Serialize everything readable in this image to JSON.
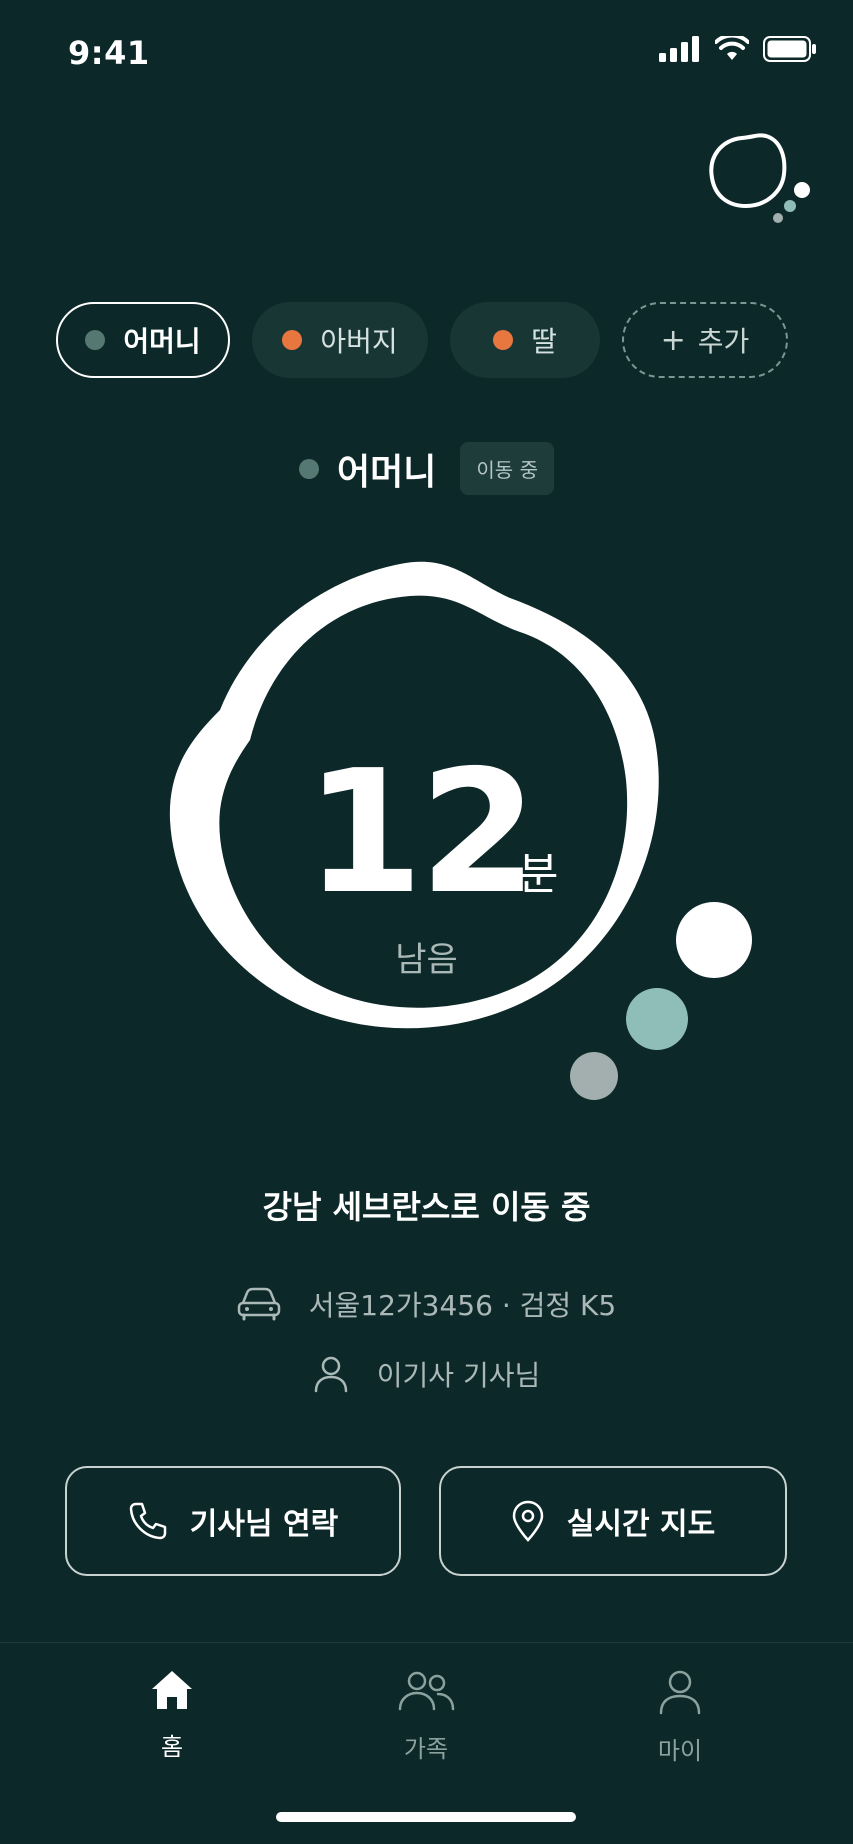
{
  "status_bar": {
    "time": "9:41"
  },
  "chips": [
    {
      "label": "어머니",
      "dot_color": "#557873",
      "active": true
    },
    {
      "label": "아버지",
      "dot_color": "#e8773f",
      "active": false
    },
    {
      "label": "딸",
      "dot_color": "#e8773f",
      "active": false
    }
  ],
  "add_chip": {
    "plus": "+",
    "label": "추가"
  },
  "selected": {
    "name": "어머니",
    "dot_color": "#557873",
    "status": "이동 중"
  },
  "eta": {
    "value": "12",
    "unit": "분",
    "sub": "남음"
  },
  "destination": "강남 세브란스로 이동 중",
  "vehicle": {
    "plate": "서울12가3456 · 검정 K5"
  },
  "driver": {
    "name": "이기사 기사님"
  },
  "actions": {
    "call_label": "기사님 연락",
    "map_label": "실시간 지도"
  },
  "nav": [
    {
      "label": "홈",
      "icon": "home-icon",
      "active": true
    },
    {
      "label": "가족",
      "icon": "family-icon",
      "active": false
    },
    {
      "label": "마이",
      "icon": "user-icon",
      "active": false
    }
  ],
  "colors": {
    "background": "#0d2828",
    "accent_orange": "#e8773f",
    "bubble_teal": "#8fbdb8",
    "bubble_gray": "#a3aeae"
  }
}
